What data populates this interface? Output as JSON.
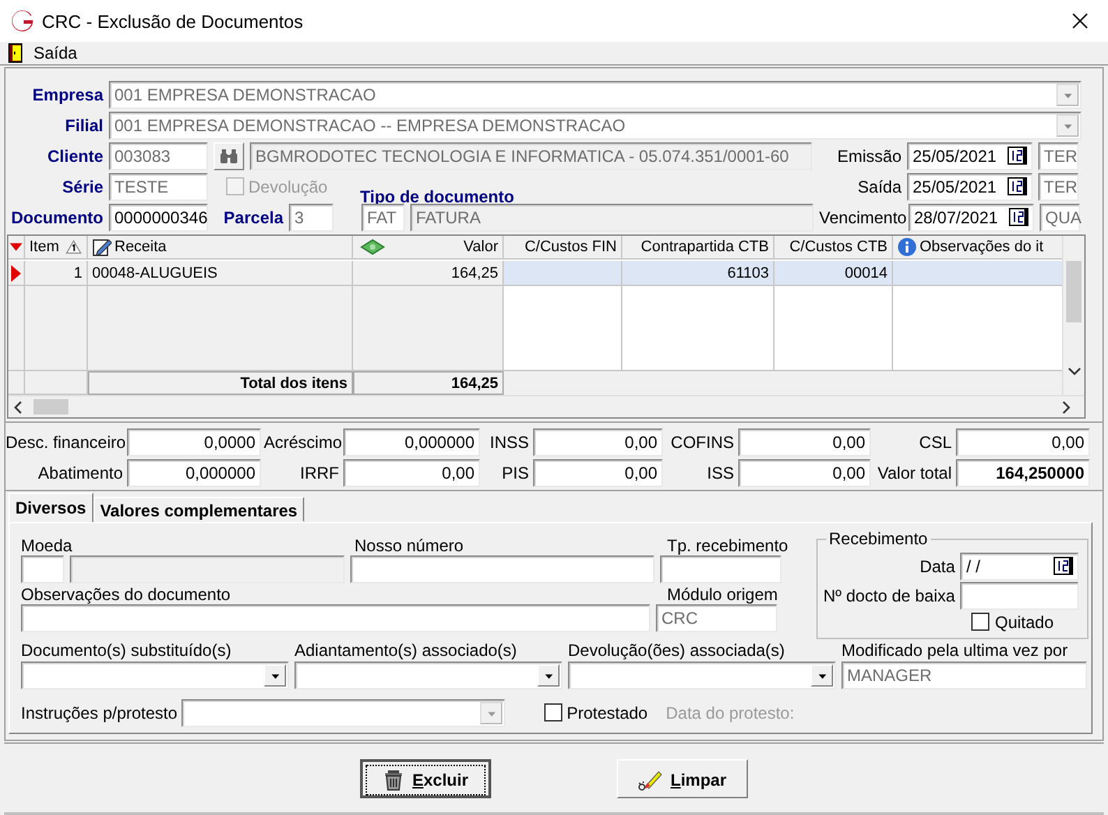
{
  "window": {
    "title": "CRC - Exclusão de Documentos"
  },
  "menu": [
    {
      "label": "Saída"
    }
  ],
  "header": {
    "empresa": {
      "label": "Empresa",
      "value": "001 EMPRESA DEMONSTRACAO"
    },
    "filial": {
      "label": "Filial",
      "value": "001 EMPRESA DEMONSTRACAO -- EMPRESA DEMONSTRACAO"
    },
    "cliente": {
      "label": "Cliente",
      "code": "003083",
      "name": "BGMRODOTEC TECNOLOGIA  E INFORMATICA - 05.074.351/0001-60"
    },
    "serie": {
      "label": "Série",
      "value": "TESTE"
    },
    "devolucao": {
      "label": "Devolução",
      "checked": false,
      "disabled": true
    },
    "documento": {
      "label": "Documento",
      "value": "0000000346"
    },
    "parcela": {
      "label": "Parcela",
      "value": "3"
    },
    "tipo_documento": {
      "label": "Tipo de documento",
      "code": "FAT",
      "name": "FATURA"
    },
    "dates": [
      {
        "label": "Emissão",
        "value": "25/05/2021",
        "weekday": "TER"
      },
      {
        "label": "Saída",
        "value": "25/05/2021",
        "weekday": "TER"
      },
      {
        "label": "Vencimento",
        "value": "28/07/2021",
        "weekday": "QUA"
      }
    ]
  },
  "grid": {
    "columns": [
      {
        "label": "Item"
      },
      {
        "label": "Receita"
      },
      {
        "label": "Valor"
      },
      {
        "label": "C/Custos FIN"
      },
      {
        "label": "Contrapartida CTB"
      },
      {
        "label": "C/Custos CTB"
      },
      {
        "label": "Observações do it"
      }
    ],
    "rows": [
      {
        "selected": true,
        "cells": [
          "1",
          "00048-ALUGUEIS",
          "164,25",
          "",
          "61103",
          "00014",
          ""
        ]
      }
    ],
    "total_label": "Total dos itens",
    "total": "164,25"
  },
  "totals": [
    {
      "label": "Desc. financeiro",
      "value": "0,0000",
      "bold": false
    },
    {
      "label": "Acréscimo",
      "value": "0,000000",
      "bold": false
    },
    {
      "label": "INSS",
      "value": "0,00",
      "bold": false
    },
    {
      "label": "COFINS",
      "value": "0,00",
      "bold": false
    },
    {
      "label": "CSL",
      "value": "0,00",
      "bold": false
    },
    {
      "label": "Abatimento",
      "value": "0,000000",
      "bold": false
    },
    {
      "label": "IRRF",
      "value": "0,00",
      "bold": false
    },
    {
      "label": "PIS",
      "value": "0,00",
      "bold": false
    },
    {
      "label": "ISS",
      "value": "0,00",
      "bold": false
    },
    {
      "label": "Valor total",
      "value": "164,250000",
      "bold": true
    }
  ],
  "tabs": [
    {
      "label": "Diversos",
      "selected": true
    },
    {
      "label": "Valores complementares",
      "selected": false
    }
  ],
  "diversos": {
    "moeda": {
      "label": "Moeda"
    },
    "nosso_numero": {
      "label": "Nosso número"
    },
    "tp_recebimento": {
      "label": "Tp. recebimento"
    },
    "observacoes": {
      "label": "Observações do documento"
    },
    "modulo_origem": {
      "label": "Módulo origem",
      "value": "CRC"
    },
    "recebimento": {
      "title": "Recebimento",
      "data_label": "Data",
      "data_value": "/ /",
      "baixa_label": "Nº docto de baixa",
      "quitado": {
        "label": "Quitado",
        "checked": false
      }
    },
    "combos": [
      {
        "label": "Documento(s) substituído(s)"
      },
      {
        "label": "Adiantamento(s) associado(s)"
      },
      {
        "label": "Devolução(ões) associada(s)"
      }
    ],
    "modificado": {
      "label": "Modificado pela ultima vez por",
      "value": "MANAGER"
    },
    "instrucoes": {
      "label": "Instruções p/protesto",
      "disabled": true
    },
    "protestado": {
      "label": "Protestado",
      "checked": false
    },
    "data_protesto": {
      "label": "Data do protesto:",
      "disabled": true
    }
  },
  "buttons": [
    {
      "label": "Excluir",
      "kind": "delete",
      "focused": true
    },
    {
      "label": "Limpar",
      "kind": "clear",
      "focused": false
    }
  ]
}
